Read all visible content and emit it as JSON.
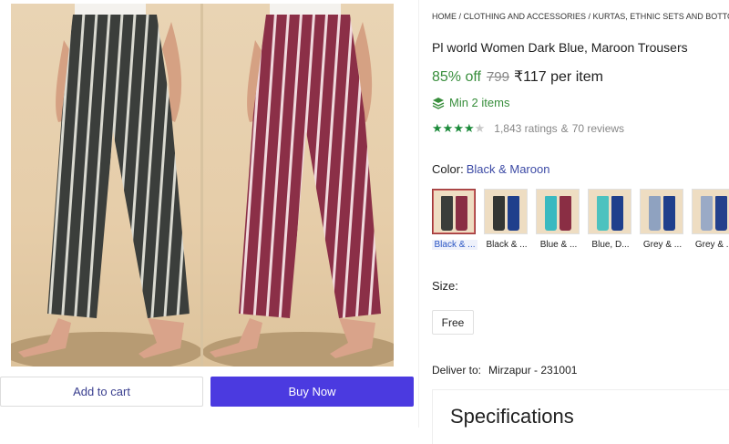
{
  "breadcrumb": "HOME / CLOTHING AND ACCESSORIES / KURTAS, ETHNIC SETS AND BOTTOMS / P",
  "product": {
    "title": "Pl world Women Dark Blue, Maroon Trousers",
    "discount": "85% off",
    "mrp": "799",
    "price": "₹117 per item",
    "min_qty": "Min 2 items",
    "rating_value": 4,
    "ratings": "1,843 ratings",
    "reviews": "70 reviews",
    "rating_sep": "&"
  },
  "color": {
    "label": "Color:",
    "selected": "Black & Maroon",
    "options": [
      {
        "label": "Black & ...",
        "c1": "#3a3d3a",
        "c2": "#8a2e44"
      },
      {
        "label": "Black & ...",
        "c1": "#343634",
        "c2": "#1f3f8c"
      },
      {
        "label": "Blue & ...",
        "c1": "#39b9c0",
        "c2": "#8a2e44"
      },
      {
        "label": "Blue, D...",
        "c1": "#4cc2bf",
        "c2": "#1f3f8c"
      },
      {
        "label": "Grey & ...",
        "c1": "#8fa2c0",
        "c2": "#1f3f8c"
      },
      {
        "label": "Grey & ...",
        "c1": "#9aaac6",
        "c2": "#24418c"
      }
    ]
  },
  "size": {
    "label": "Size:",
    "option": "Free"
  },
  "delivery": {
    "label": "Deliver to:",
    "location": "Mirzapur - 231001"
  },
  "specs": {
    "title": "Specifications"
  },
  "actions": {
    "add_to_cart": "Add to cart",
    "buy_now": "Buy Now"
  },
  "colors": {
    "accent": "#4b3ae0",
    "green": "#388e3c",
    "link": "#3c4aa5"
  }
}
